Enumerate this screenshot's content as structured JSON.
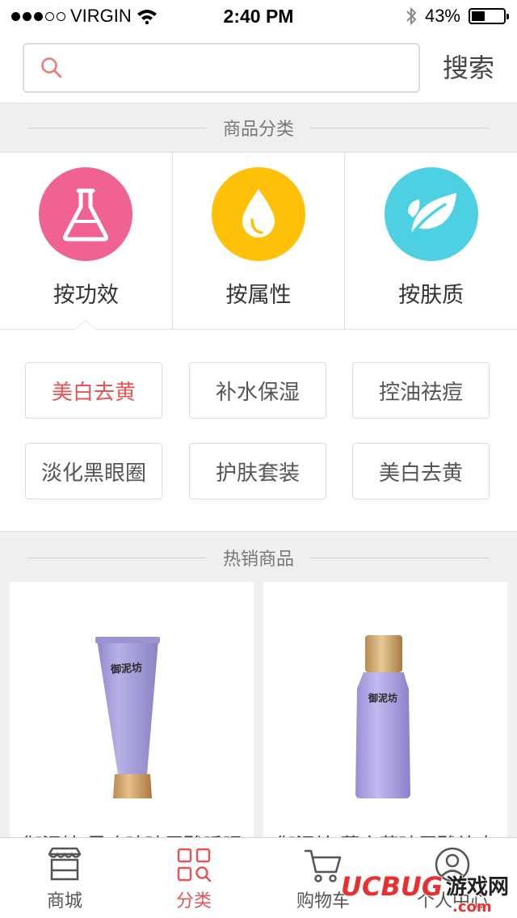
{
  "status_bar": {
    "carrier": "VIRGIN",
    "time": "2:40 PM",
    "battery_text": "43%",
    "battery_level": 0.43,
    "signal_bars_filled": 3,
    "signal_bars_total": 5,
    "icons": [
      "wifi-icon",
      "bluetooth-icon",
      "battery-icon"
    ]
  },
  "search": {
    "placeholder": "",
    "value": "",
    "button_label": "搜索",
    "icon": "search-icon"
  },
  "sections": {
    "category_title": "商品分类",
    "hot_title": "热销商品"
  },
  "categories": [
    {
      "label": "按功效",
      "icon": "flask-icon",
      "color": "#f06292",
      "selected": true
    },
    {
      "label": "按属性",
      "icon": "drop-icon",
      "color": "#ffc107",
      "selected": false
    },
    {
      "label": "按肤质",
      "icon": "leaf-icon",
      "color": "#4dd0e1",
      "selected": false
    }
  ],
  "tags": [
    {
      "label": "美白去黄",
      "active": true
    },
    {
      "label": "补水保湿",
      "active": false
    },
    {
      "label": "控油祛痘",
      "active": false
    },
    {
      "label": "淡化黑眼圈",
      "active": false
    },
    {
      "label": "护肤套装",
      "active": false
    },
    {
      "label": "美白去黄",
      "active": false
    }
  ],
  "products": [
    {
      "name": "御泥坊 黑玫瑰玻尿酸睡眠",
      "brand_mark": "御泥坊",
      "image_icon": "purple-tube-image"
    },
    {
      "name": "御泥坊 薰衣草玻尿酸补水",
      "brand_mark": "御泥坊",
      "image_icon": "purple-bottle-image"
    }
  ],
  "tab_bar": [
    {
      "label": "商城",
      "icon": "store-icon",
      "active": false
    },
    {
      "label": "分类",
      "icon": "category-grid-icon",
      "active": true
    },
    {
      "label": "购物车",
      "icon": "cart-icon",
      "active": false
    },
    {
      "label": "个人中心",
      "icon": "user-icon",
      "active": false
    }
  ],
  "watermark": {
    "text1": "UCBUG",
    "text2": "游戏网",
    "text3": ".com"
  },
  "colors": {
    "accent": "#e85454",
    "tag_active": "#e85454"
  }
}
